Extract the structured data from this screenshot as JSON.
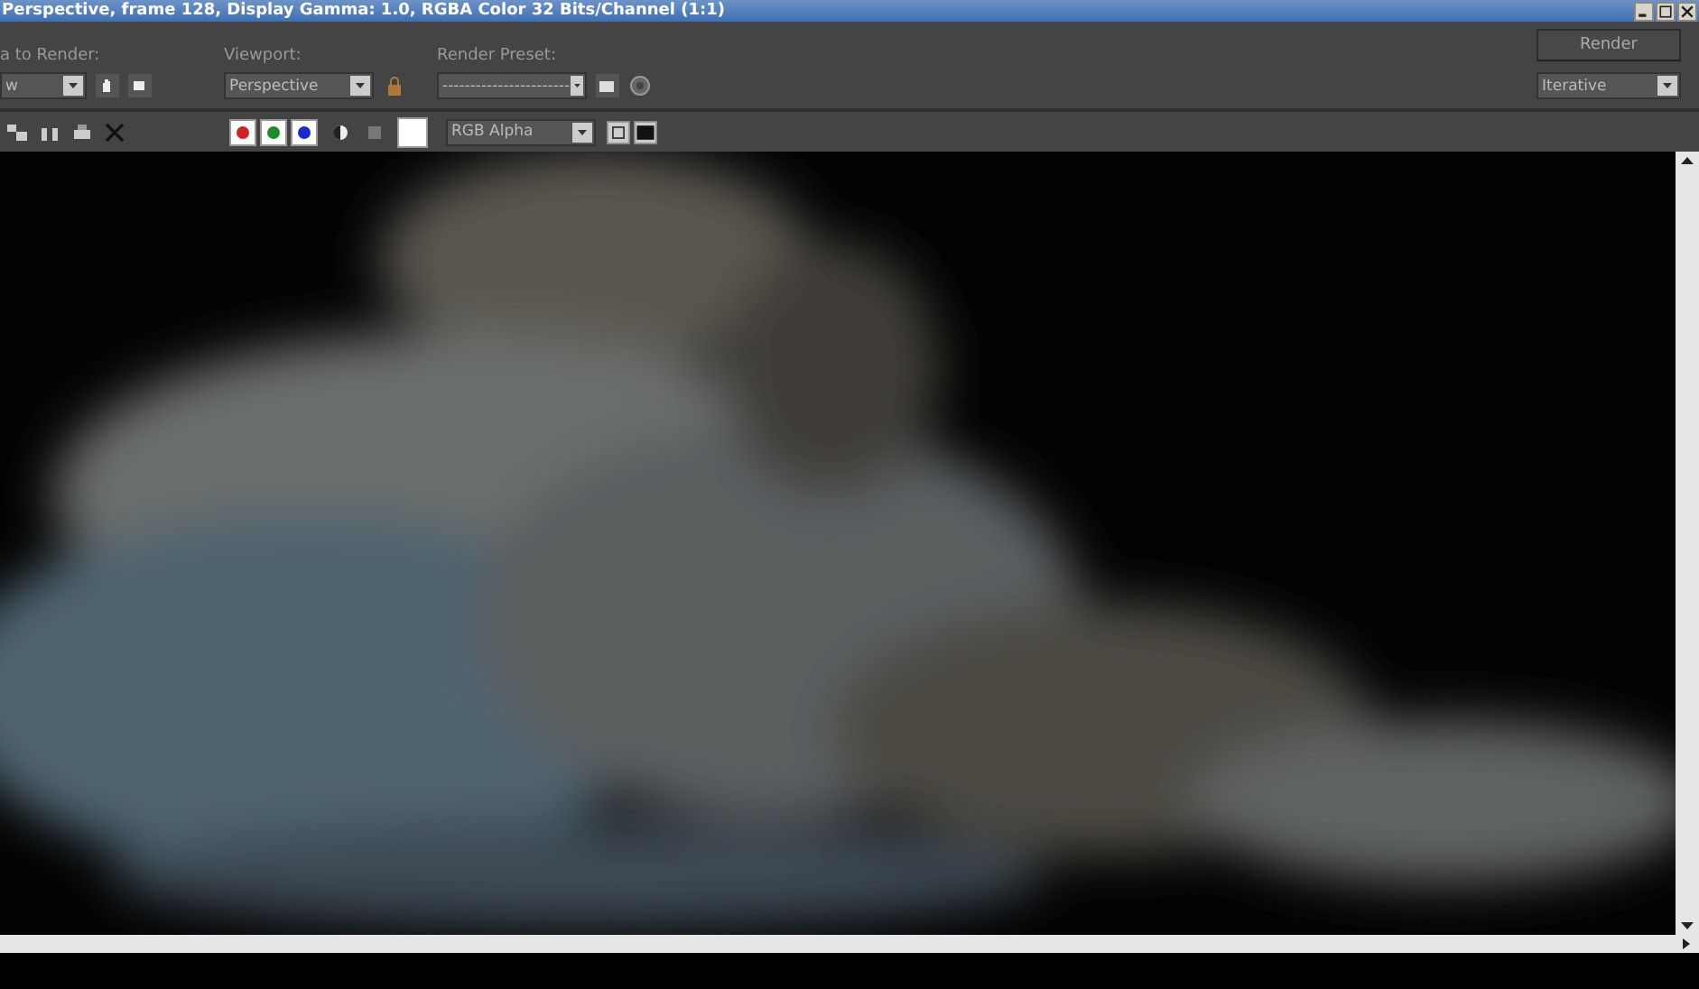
{
  "window": {
    "title": "Perspective, frame 128, Display Gamma: 1.0, RGBA Color 32 Bits/Channel (1:1)"
  },
  "area_to_render": {
    "label": "a to Render:",
    "value": "w"
  },
  "viewport": {
    "label": "Viewport:",
    "value": "Perspective"
  },
  "render_preset": {
    "label": "Render Preset:",
    "value": "-----------------------"
  },
  "render_button": "Render",
  "render_mode": {
    "value": "Iterative"
  },
  "channels": [
    {
      "color": "#d42020",
      "on": true
    },
    {
      "color": "#1e8a2a",
      "on": true
    },
    {
      "color": "#1a2ad0",
      "on": true
    }
  ],
  "display_channel": {
    "value": "RGB Alpha"
  }
}
